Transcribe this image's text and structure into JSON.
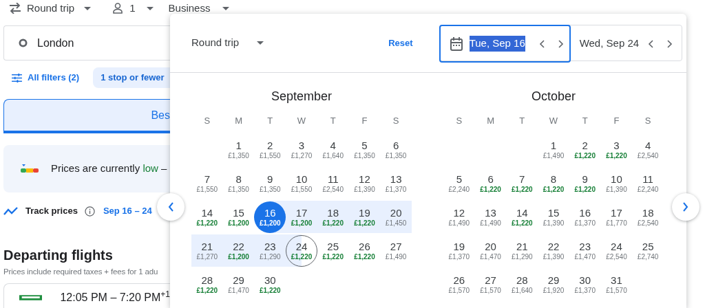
{
  "top_bar": {
    "trip_type": "Round trip",
    "passengers": "1",
    "cabin": "Business"
  },
  "origin": {
    "value": "London"
  },
  "filters": {
    "all_filters": "All filters (2)",
    "chips": [
      {
        "label": "1 stop or fewer",
        "selected": true
      }
    ]
  },
  "sort_tabs": [
    {
      "label": "Bes",
      "selected": true
    }
  ],
  "insight": {
    "prefix": "Prices are currently ",
    "highlight": "low",
    "suffix": " –"
  },
  "track": {
    "label": "Track prices",
    "dates": "Sep 16 – 24"
  },
  "departing": {
    "title": "Departing flights",
    "subtitle": "Prices include required taxes + fees for 1 adu"
  },
  "flights": [
    {
      "times": "12:05 PM – 7:20 PM$^{+1}$"
    }
  ],
  "date_picker": {
    "trip_type": "Round trip",
    "reset": "Reset",
    "date_fields": [
      {
        "value": "Tue, Sep 16",
        "focused": true,
        "text_highlighted": true
      },
      {
        "value": "Wed, Sep 24",
        "focused": false,
        "text_highlighted": false
      }
    ],
    "months": [
      {
        "name": "September",
        "weekdays": [
          "S",
          "M",
          "T",
          "W",
          "T",
          "F",
          "S"
        ],
        "weeks": [
          [
            {
              "day": "1",
              "price": "£1,350",
              "low_price": false,
              "selected": false,
              "kind": "day",
              "in_range": false
            },
            {
              "day": "2",
              "price": "£1,550",
              "low_price": false,
              "selected": false,
              "kind": "day",
              "in_range": false
            },
            {
              "day": "3",
              "price": "£1,270",
              "low_price": false,
              "selected": false,
              "kind": "day",
              "in_range": false
            },
            {
              "day": "4",
              "price": "£1,640",
              "low_price": false,
              "selected": false,
              "kind": "day",
              "in_range": false
            },
            {
              "day": "5",
              "price": "£1,350",
              "low_price": false,
              "selected": false,
              "kind": "day",
              "in_range": false
            },
            {
              "day": "6",
              "price": "£1,350",
              "low_price": false,
              "selected": false,
              "kind": "day",
              "in_range": false
            }
          ],
          [
            {
              "day": "7",
              "price": "£1,550",
              "low_price": false,
              "selected": false,
              "kind": "day",
              "in_range": false
            },
            {
              "day": "8",
              "price": "£1,350",
              "low_price": false,
              "selected": false,
              "kind": "day",
              "in_range": false
            },
            {
              "day": "9",
              "price": "£1,350",
              "low_price": false,
              "selected": false,
              "kind": "day",
              "in_range": false
            },
            {
              "day": "10",
              "price": "£1,550",
              "low_price": false,
              "selected": false,
              "kind": "day",
              "in_range": false
            },
            {
              "day": "11",
              "price": "£2,540",
              "low_price": false,
              "selected": false,
              "kind": "day",
              "in_range": false
            },
            {
              "day": "12",
              "price": "£1,390",
              "low_price": false,
              "selected": false,
              "kind": "day",
              "in_range": false
            },
            {
              "day": "13",
              "price": "£1,370",
              "low_price": false,
              "selected": false,
              "kind": "day",
              "in_range": false
            }
          ],
          [
            {
              "day": "14",
              "price": "£1,220",
              "low_price": true,
              "selected": false,
              "kind": "day",
              "in_range": false
            },
            {
              "day": "15",
              "price": "£1,200",
              "low_price": true,
              "selected": false,
              "kind": "day",
              "in_range": false
            },
            {
              "day": "16",
              "price": "£1,200",
              "low_price": true,
              "selected": true,
              "kind": "departure",
              "in_range": true
            },
            {
              "day": "17",
              "price": "£1,200",
              "low_price": true,
              "selected": false,
              "kind": "day",
              "in_range": true
            },
            {
              "day": "18",
              "price": "£1,220",
              "low_price": true,
              "selected": false,
              "kind": "day",
              "in_range": true
            },
            {
              "day": "19",
              "price": "£1,220",
              "low_price": true,
              "selected": false,
              "kind": "day",
              "in_range": true
            },
            {
              "day": "20",
              "price": "£1,450",
              "low_price": false,
              "selected": false,
              "kind": "day",
              "in_range": true
            }
          ],
          [
            {
              "day": "21",
              "price": "£1,270",
              "low_price": false,
              "selected": false,
              "kind": "day",
              "in_range": true
            },
            {
              "day": "22",
              "price": "£1,200",
              "low_price": true,
              "selected": false,
              "kind": "day",
              "in_range": true
            },
            {
              "day": "23",
              "price": "£1,290",
              "low_price": false,
              "selected": false,
              "kind": "day",
              "in_range": true
            },
            {
              "day": "24",
              "price": "£1,220",
              "low_price": true,
              "selected": true,
              "kind": "return",
              "in_range": true
            },
            {
              "day": "25",
              "price": "£1,220",
              "low_price": true,
              "selected": false,
              "kind": "day",
              "in_range": false
            },
            {
              "day": "26",
              "price": "£1,220",
              "low_price": true,
              "selected": false,
              "kind": "day",
              "in_range": false
            },
            {
              "day": "27",
              "price": "£1,490",
              "low_price": false,
              "selected": false,
              "kind": "day",
              "in_range": false
            }
          ],
          [
            {
              "day": "28",
              "price": "£1,220",
              "low_price": true,
              "selected": false,
              "kind": "day",
              "in_range": false
            },
            {
              "day": "29",
              "price": "£1,470",
              "low_price": false,
              "selected": false,
              "kind": "day",
              "in_range": false
            },
            {
              "day": "30",
              "price": "£1,220",
              "low_price": true,
              "selected": false,
              "kind": "day",
              "in_range": false
            }
          ]
        ]
      },
      {
        "name": "October",
        "weekdays": [
          "S",
          "M",
          "T",
          "W",
          "T",
          "F",
          "S"
        ],
        "weeks": [
          [
            {
              "day": "1",
              "price": "£1,490",
              "low_price": false,
              "selected": false,
              "kind": "day",
              "in_range": false
            },
            {
              "day": "2",
              "price": "£1,220",
              "low_price": true,
              "selected": false,
              "kind": "day",
              "in_range": false
            },
            {
              "day": "3",
              "price": "£1,220",
              "low_price": true,
              "selected": false,
              "kind": "day",
              "in_range": false
            },
            {
              "day": "4",
              "price": "£2,540",
              "low_price": false,
              "selected": false,
              "kind": "day",
              "in_range": false
            }
          ],
          [
            {
              "day": "5",
              "price": "£2,240",
              "low_price": false,
              "selected": false,
              "kind": "day",
              "in_range": false
            },
            {
              "day": "6",
              "price": "£1,220",
              "low_price": true,
              "selected": false,
              "kind": "day",
              "in_range": false
            },
            {
              "day": "7",
              "price": "£1,220",
              "low_price": true,
              "selected": false,
              "kind": "day",
              "in_range": false
            },
            {
              "day": "8",
              "price": "£1,220",
              "low_price": true,
              "selected": false,
              "kind": "day",
              "in_range": false
            },
            {
              "day": "9",
              "price": "£1,220",
              "low_price": true,
              "selected": false,
              "kind": "day",
              "in_range": false
            },
            {
              "day": "10",
              "price": "£1,390",
              "low_price": false,
              "selected": false,
              "kind": "day",
              "in_range": false
            },
            {
              "day": "11",
              "price": "£2,240",
              "low_price": false,
              "selected": false,
              "kind": "day",
              "in_range": false
            }
          ],
          [
            {
              "day": "12",
              "price": "£1,490",
              "low_price": false,
              "selected": false,
              "kind": "day",
              "in_range": false
            },
            {
              "day": "13",
              "price": "£1,490",
              "low_price": false,
              "selected": false,
              "kind": "day",
              "in_range": false
            },
            {
              "day": "14",
              "price": "£1,220",
              "low_price": true,
              "selected": false,
              "kind": "day",
              "in_range": false
            },
            {
              "day": "15",
              "price": "£1,390",
              "low_price": false,
              "selected": false,
              "kind": "day",
              "in_range": false
            },
            {
              "day": "16",
              "price": "£1,370",
              "low_price": false,
              "selected": false,
              "kind": "day",
              "in_range": false
            },
            {
              "day": "17",
              "price": "£1,770",
              "low_price": false,
              "selected": false,
              "kind": "day",
              "in_range": false
            },
            {
              "day": "18",
              "price": "£2,540",
              "low_price": false,
              "selected": false,
              "kind": "day",
              "in_range": false
            }
          ],
          [
            {
              "day": "19",
              "price": "£1,370",
              "low_price": false,
              "selected": false,
              "kind": "day",
              "in_range": false
            },
            {
              "day": "20",
              "price": "£1,470",
              "low_price": false,
              "selected": false,
              "kind": "day",
              "in_range": false
            },
            {
              "day": "21",
              "price": "£1,290",
              "low_price": false,
              "selected": false,
              "kind": "day",
              "in_range": false
            },
            {
              "day": "22",
              "price": "£1,390",
              "low_price": false,
              "selected": false,
              "kind": "day",
              "in_range": false
            },
            {
              "day": "23",
              "price": "£1,470",
              "low_price": false,
              "selected": false,
              "kind": "day",
              "in_range": false
            },
            {
              "day": "24",
              "price": "£2,540",
              "low_price": false,
              "selected": false,
              "kind": "day",
              "in_range": false
            },
            {
              "day": "25",
              "price": "£2,740",
              "low_price": false,
              "selected": false,
              "kind": "day",
              "in_range": false
            }
          ],
          [
            {
              "day": "26",
              "price": "£1,570",
              "low_price": false,
              "selected": false,
              "kind": "day",
              "in_range": false
            },
            {
              "day": "27",
              "price": "£1,570",
              "low_price": false,
              "selected": false,
              "kind": "day",
              "in_range": false
            },
            {
              "day": "28",
              "price": "£1,640",
              "low_price": false,
              "selected": false,
              "kind": "day",
              "in_range": false
            },
            {
              "day": "29",
              "price": "£1,920",
              "low_price": false,
              "selected": false,
              "kind": "day",
              "in_range": false
            },
            {
              "day": "30",
              "price": "£1,370",
              "low_price": false,
              "selected": false,
              "kind": "day",
              "in_range": false
            },
            {
              "day": "31",
              "price": "£1,570",
              "low_price": false,
              "selected": false,
              "kind": "day",
              "in_range": false
            }
          ]
        ]
      }
    ]
  }
}
